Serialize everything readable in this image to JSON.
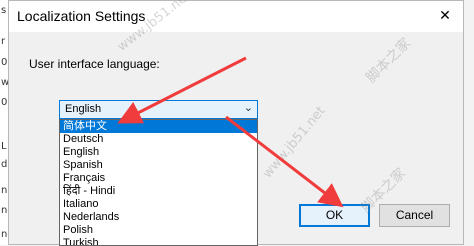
{
  "backdrop": {
    "chars": [
      "s",
      "r",
      "0",
      "w",
      "0",
      "L",
      "d",
      "n",
      "n",
      "n"
    ]
  },
  "dialog": {
    "title": "Localization Settings",
    "close_glyph": "✕",
    "label": "User interface language:",
    "select": {
      "value": "English",
      "chevron": "⌄"
    },
    "options": [
      "简体中文",
      "Deutsch",
      "English",
      "Spanish",
      "Français",
      "हिंदी - Hindi",
      "Italiano",
      "Nederlands",
      "Polish",
      "Turkish"
    ],
    "highlighted_index": 0,
    "ok_label": "OK",
    "cancel_label": "Cancel"
  },
  "watermarks": [
    "www.jb51.net",
    "脚本之家",
    "www.jb51.net",
    "脚本之家"
  ],
  "colors": {
    "accent": "#0078d7",
    "annotation_arrow": "#f03c3c"
  }
}
